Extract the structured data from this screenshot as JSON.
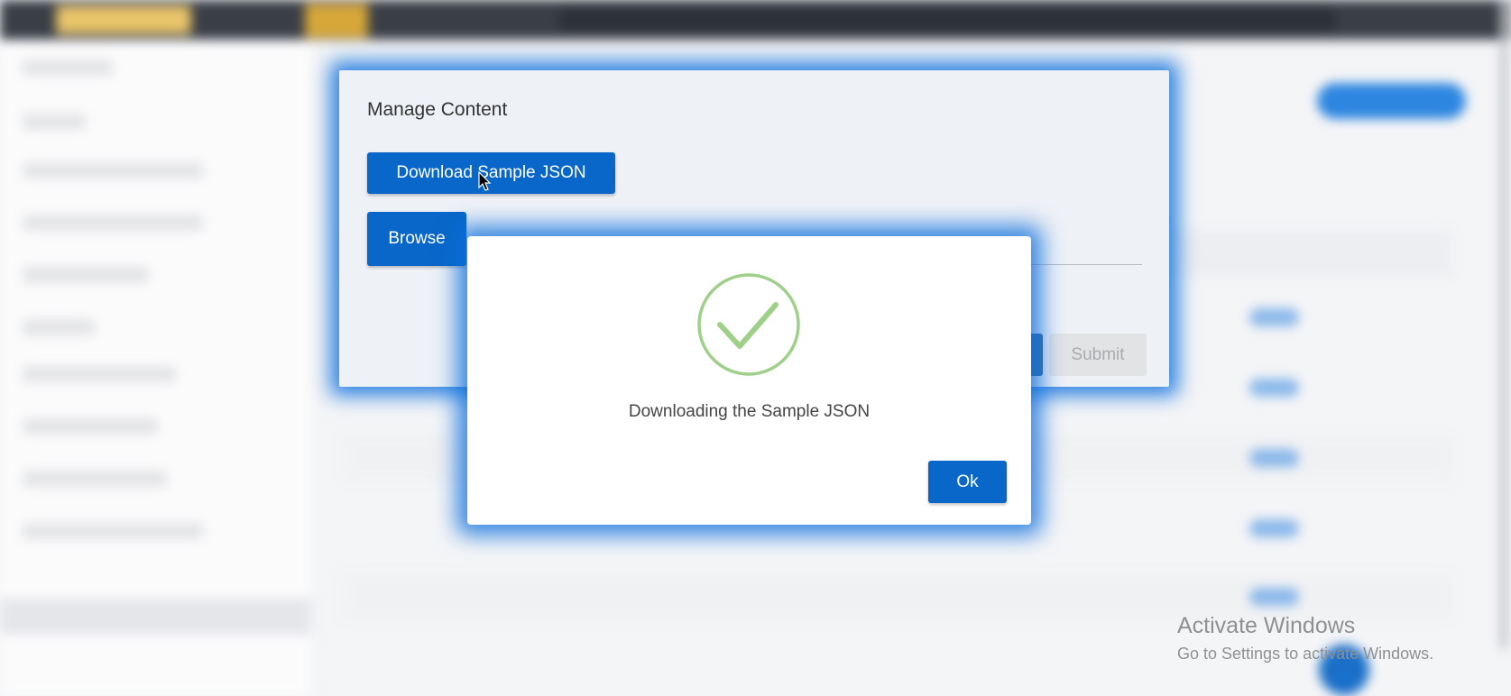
{
  "dialog": {
    "title": "Manage Content",
    "download_label": "Download Sample JSON",
    "browse_label": "Browse",
    "submit_label": "Submit"
  },
  "alert": {
    "icon": "check-circle-icon",
    "message": "Downloading the Sample JSON",
    "ok_label": "Ok",
    "success_color": "#9fd08a"
  },
  "accent_color": "#0867c8",
  "watermark": {
    "line1": "Activate Windows",
    "line2": "Go to Settings to activate Windows."
  }
}
